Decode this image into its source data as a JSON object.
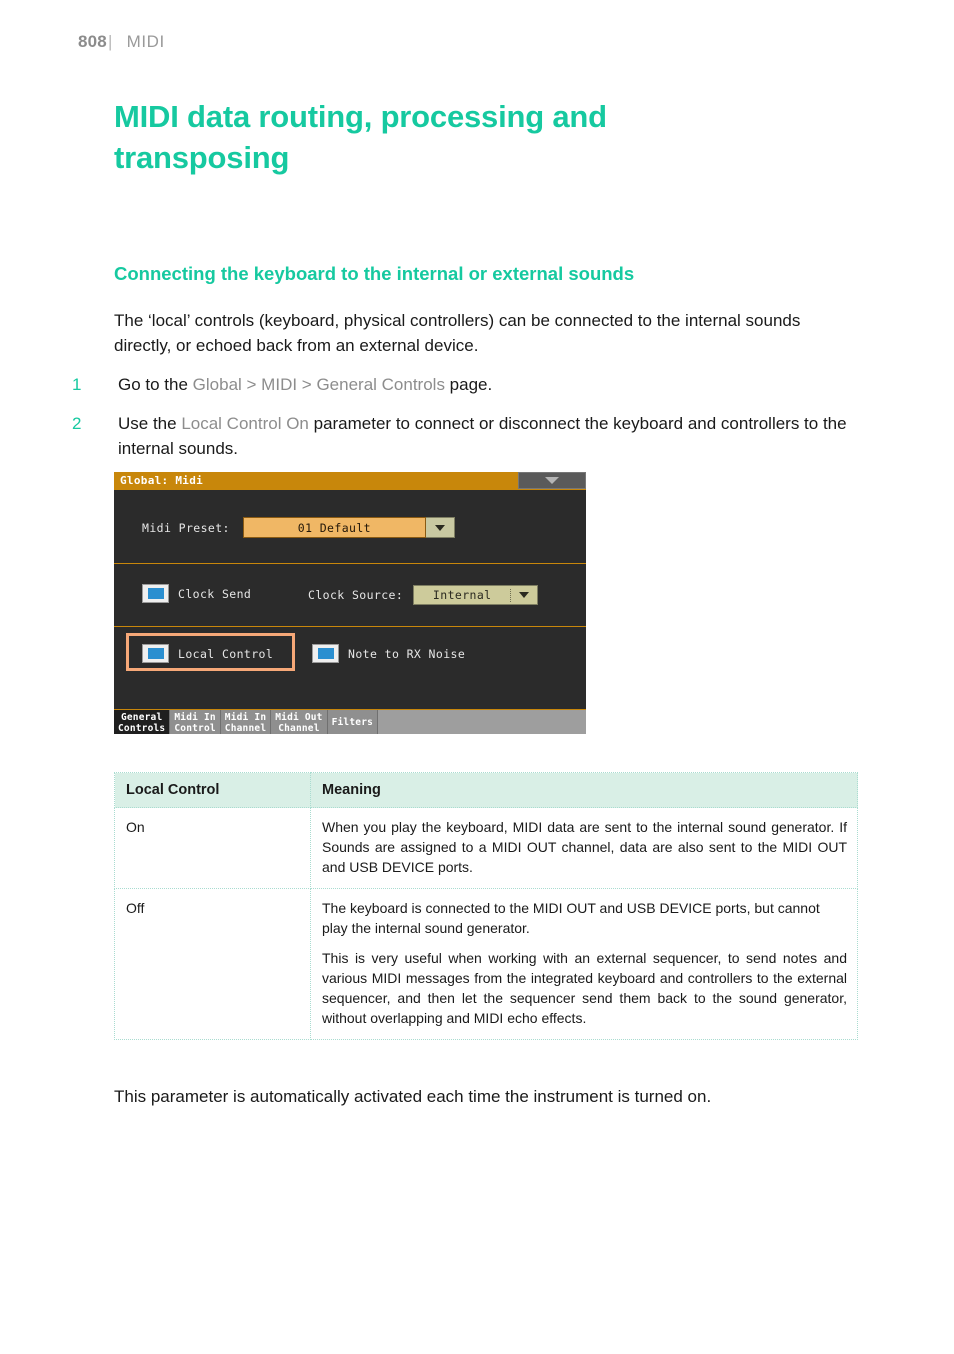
{
  "header": {
    "page_number": "808",
    "separator": "|",
    "chapter": "MIDI"
  },
  "title": "MIDI data routing, processing and transposing",
  "section_title": "Connecting the keyboard to the internal or external sounds",
  "intro_paragraph": "The ‘local’ controls (keyboard, physical controllers) can be connected to the internal sounds directly, or echoed back from an external device.",
  "steps": [
    {
      "number": "1",
      "text_before": "Go to the ",
      "ui_ref": "Global > MIDI > General Controls",
      "text_after": " page."
    },
    {
      "number": "2",
      "text_before": "Use the ",
      "ui_ref": "Local Control On",
      "text_after": " parameter to connect or disconnect the keyboard and controllers to the internal sounds."
    }
  ],
  "device_screenshot": {
    "window_title": "Global: Midi",
    "menu_icon": "caret-down-icon",
    "preset": {
      "label": "Midi Preset:",
      "value": "01 Default",
      "dropdown_icon": "caret-down-icon"
    },
    "clock_send": {
      "label": "Clock Send",
      "checked": true
    },
    "clock_source": {
      "label": "Clock Source:",
      "value": "Internal",
      "dropdown_icon": "caret-down-icon"
    },
    "local_control": {
      "label": "Local Control",
      "checked": true,
      "highlighted": true
    },
    "note_to_rx_noise": {
      "label": "Note to RX Noise",
      "checked": true
    },
    "tabs": [
      {
        "line1": "General",
        "line2": "Controls",
        "active": true
      },
      {
        "line1": "Midi In",
        "line2": "Control",
        "active": false
      },
      {
        "line1": "Midi In",
        "line2": "Channel",
        "active": false
      },
      {
        "line1": "Midi Out",
        "line2": "Channel",
        "active": false
      },
      {
        "line1": "Filters",
        "line2": "",
        "active": false
      }
    ],
    "colors": {
      "titlebar": "#c8870b",
      "background": "#2b2b2b",
      "preset_field": "#f0b765",
      "combo_field": "#cdcb9b",
      "checkbox_fill": "#2b8fd0",
      "highlight_border": "#f6a878"
    }
  },
  "table": {
    "headers": [
      "Local Control",
      "Meaning"
    ],
    "rows": [
      {
        "key": "On",
        "paragraphs": [
          "When you play the keyboard, MIDI data are sent to the internal sound generator. If Sounds are assigned to a MIDI OUT channel, data are also sent to the MIDI OUT and USB DEVICE ports."
        ]
      },
      {
        "key": "Off",
        "paragraphs": [
          "The keyboard is connected to the MIDI OUT and USB DEVICE ports, but cannot play the internal sound generator.",
          "This is very useful when working with an external sequencer, to send notes and various MIDI messages from the integrated keyboard and controllers to the external sequencer, and then let the sequencer send them back to the sound generator, without overlapping and MIDI echo effects."
        ]
      }
    ]
  },
  "closing_paragraph": "This parameter is automatically activated each time the instrument is turned on.",
  "theme": {
    "accent": "#16c9a0",
    "table_header_bg": "#d9efe6",
    "ui_ref_color": "#8d8d8d"
  }
}
